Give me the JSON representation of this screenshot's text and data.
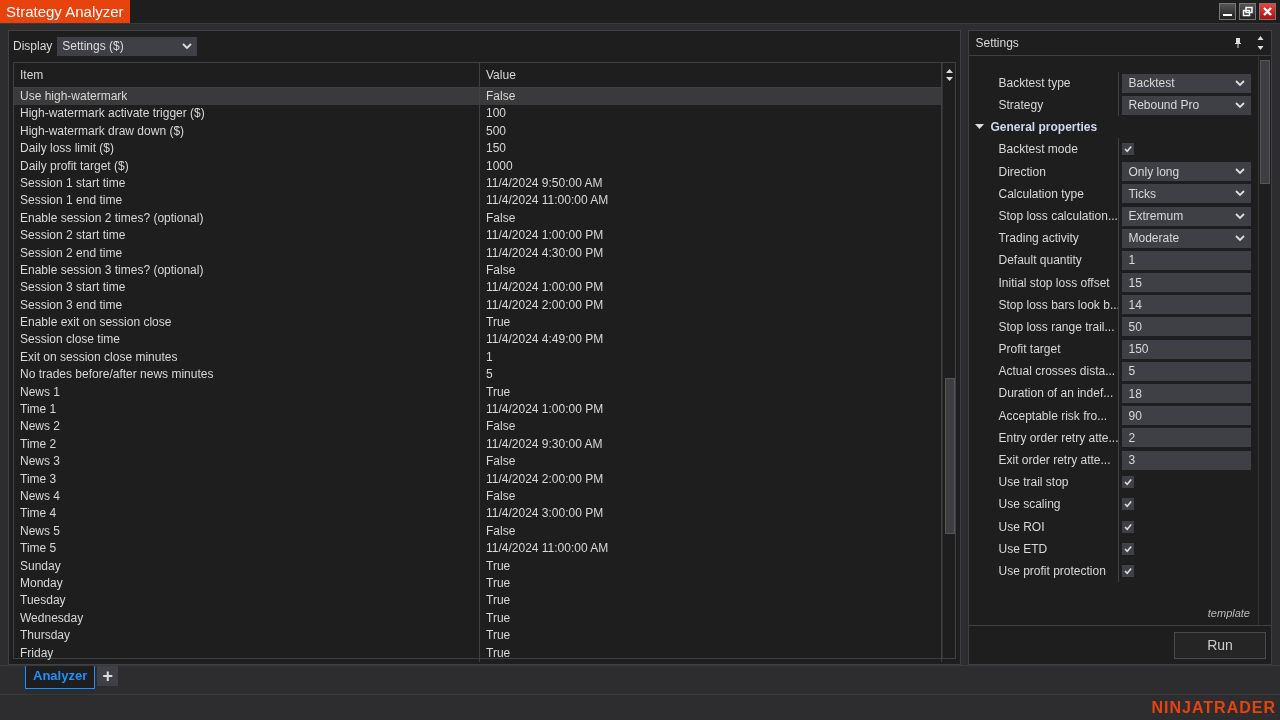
{
  "window": {
    "title": "Strategy Analyzer"
  },
  "display": {
    "label": "Display",
    "value": "Settings ($)"
  },
  "table": {
    "columns": [
      "Item",
      "Value"
    ],
    "rows": [
      {
        "item": "Use high-watermark",
        "value": "False",
        "selected": true
      },
      {
        "item": "High-watermark activate trigger ($)",
        "value": "100",
        "selected": false
      },
      {
        "item": "High-watermark draw down ($)",
        "value": "500",
        "selected": false
      },
      {
        "item": "Daily loss limit ($)",
        "value": "150",
        "selected": false
      },
      {
        "item": "Daily profit target ($)",
        "value": "1000",
        "selected": false
      },
      {
        "item": "Session 1 start time",
        "value": "11/4/2024 9:50:00 AM",
        "selected": false
      },
      {
        "item": "Session 1 end time",
        "value": "11/4/2024 11:00:00 AM",
        "selected": false
      },
      {
        "item": "Enable session 2 times? (optional)",
        "value": "False",
        "selected": false
      },
      {
        "item": "Session 2 start time",
        "value": "11/4/2024 1:00:00 PM",
        "selected": false
      },
      {
        "item": "Session 2 end time",
        "value": "11/4/2024 4:30:00 PM",
        "selected": false
      },
      {
        "item": "Enable session 3 times? (optional)",
        "value": "False",
        "selected": false
      },
      {
        "item": "Session 3 start time",
        "value": "11/4/2024 1:00:00 PM",
        "selected": false
      },
      {
        "item": "Session 3 end time",
        "value": "11/4/2024 2:00:00 PM",
        "selected": false
      },
      {
        "item": "Enable exit on session close",
        "value": "True",
        "selected": false
      },
      {
        "item": "Session close time",
        "value": "11/4/2024 4:49:00 PM",
        "selected": false
      },
      {
        "item": "Exit on session close minutes",
        "value": "1",
        "selected": false
      },
      {
        "item": "No trades before/after news minutes",
        "value": "5",
        "selected": false
      },
      {
        "item": "News 1",
        "value": "True",
        "selected": false
      },
      {
        "item": "Time 1",
        "value": "11/4/2024 1:00:00 PM",
        "selected": false
      },
      {
        "item": "News 2",
        "value": "False",
        "selected": false
      },
      {
        "item": "Time 2",
        "value": "11/4/2024 9:30:00 AM",
        "selected": false
      },
      {
        "item": "News 3",
        "value": "False",
        "selected": false
      },
      {
        "item": "Time 3",
        "value": "11/4/2024 2:00:00 PM",
        "selected": false
      },
      {
        "item": "News 4",
        "value": "False",
        "selected": false
      },
      {
        "item": "Time 4",
        "value": "11/4/2024 3:00:00 PM",
        "selected": false
      },
      {
        "item": "News 5",
        "value": "False",
        "selected": false
      },
      {
        "item": "Time 5",
        "value": "11/4/2024 11:00:00 AM",
        "selected": false
      },
      {
        "item": "Sunday",
        "value": "True",
        "selected": false
      },
      {
        "item": "Monday",
        "value": "True",
        "selected": false
      },
      {
        "item": "Tuesday",
        "value": "True",
        "selected": false
      },
      {
        "item": "Wednesday",
        "value": "True",
        "selected": false
      },
      {
        "item": "Thursday",
        "value": "True",
        "selected": false
      },
      {
        "item": "Friday",
        "value": "True",
        "selected": false
      }
    ]
  },
  "settings": {
    "title": "Settings",
    "properties": [
      {
        "kind": "dropdown",
        "label": "Backtest type",
        "value": "Backtest"
      },
      {
        "kind": "dropdown",
        "label": "Strategy",
        "value": "Rebound Pro"
      }
    ],
    "groups": [
      {
        "name": "General properties",
        "expanded": true,
        "properties": [
          {
            "kind": "checkbox",
            "label": "Backtest mode",
            "checked": true
          },
          {
            "kind": "dropdown",
            "label": "Direction",
            "value": "Only long"
          },
          {
            "kind": "dropdown",
            "label": "Calculation type",
            "value": "Ticks"
          },
          {
            "kind": "dropdown",
            "label": "Stop loss calculation...",
            "value": "Extremum"
          },
          {
            "kind": "dropdown",
            "label": "Trading activity",
            "value": "Moderate"
          },
          {
            "kind": "text",
            "label": "Default quantity",
            "value": "1"
          },
          {
            "kind": "text",
            "label": "Initial stop loss offset",
            "value": "15"
          },
          {
            "kind": "text",
            "label": "Stop loss bars look b...",
            "value": "14"
          },
          {
            "kind": "text",
            "label": "Stop loss range trail...",
            "value": "50"
          },
          {
            "kind": "text",
            "label": "Profit target",
            "value": "150"
          },
          {
            "kind": "text",
            "label": "Actual crosses dista...",
            "value": "5"
          },
          {
            "kind": "text",
            "label": "Duration of an indef...",
            "value": "18"
          },
          {
            "kind": "text",
            "label": "Acceptable risk fro...",
            "value": "90"
          },
          {
            "kind": "text",
            "label": "Entry order retry atte...",
            "value": "2"
          },
          {
            "kind": "text",
            "label": "Exit order retry atte...",
            "value": "3"
          },
          {
            "kind": "checkbox",
            "label": "Use trail stop",
            "checked": true
          },
          {
            "kind": "checkbox",
            "label": "Use scaling",
            "checked": true
          },
          {
            "kind": "checkbox",
            "label": "Use ROI",
            "checked": true
          },
          {
            "kind": "checkbox",
            "label": "Use ETD",
            "checked": true
          },
          {
            "kind": "checkbox",
            "label": "Use profit protection",
            "checked": true
          }
        ]
      }
    ],
    "template": "template",
    "run_button": "Run"
  },
  "tabs": [
    {
      "label": "Analyzer",
      "selected": true
    }
  ],
  "add_tab": "+",
  "brand": "NINJATRADER"
}
